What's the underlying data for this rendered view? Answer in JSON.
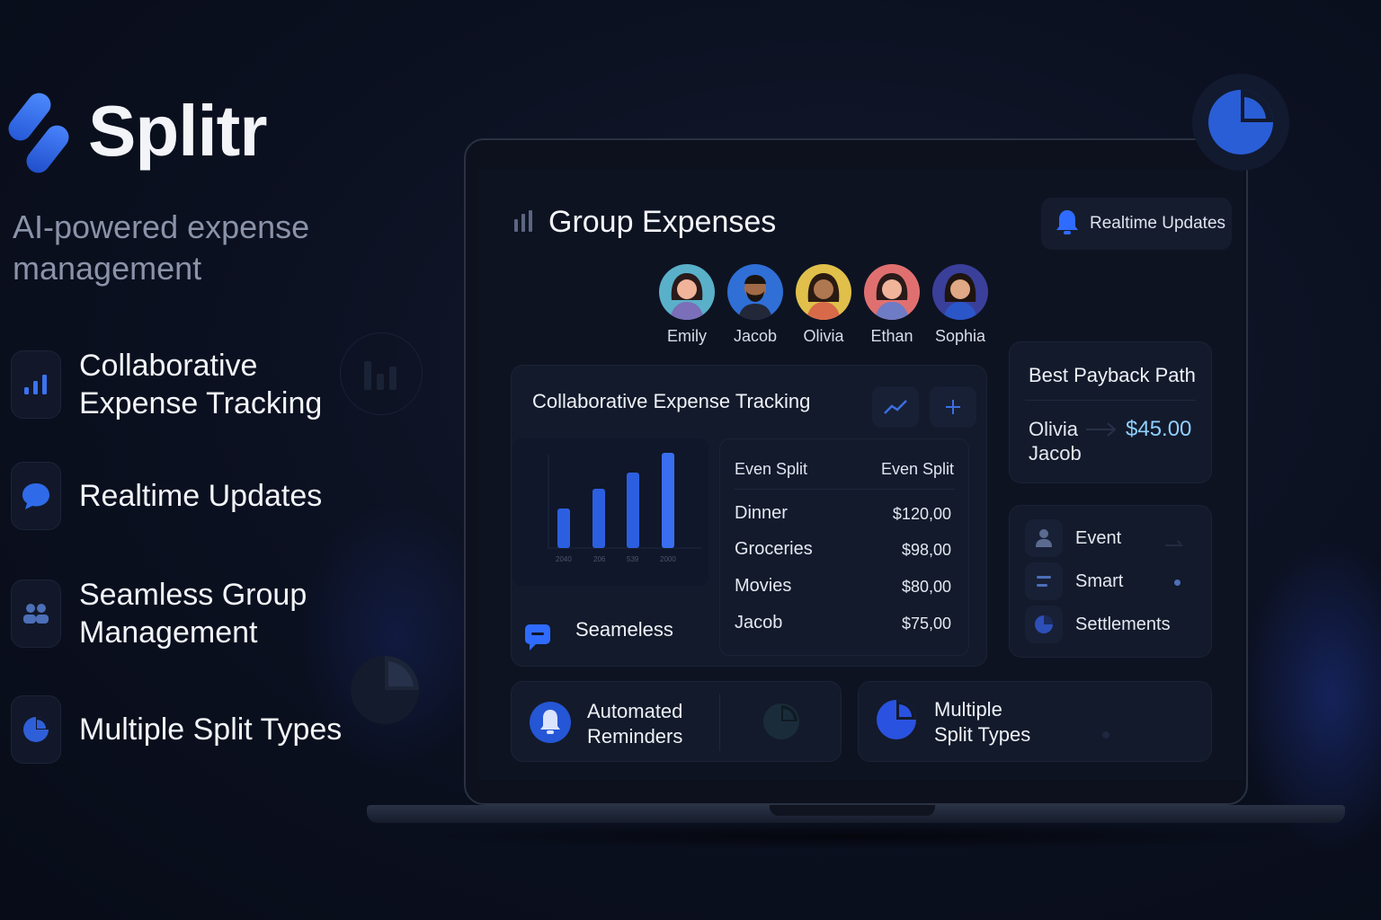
{
  "brand": {
    "name": "Splitr",
    "tagline": "AI-powered expense management"
  },
  "features": [
    {
      "label": "Collaborative Expense Tracking",
      "icon": "bar-chart-icon"
    },
    {
      "label": "Realtime Updates",
      "icon": "chat-bubble-icon"
    },
    {
      "label": "Seamless Group Management",
      "icon": "group-icon"
    },
    {
      "label": "Multiple Split Types",
      "icon": "pie-chart-icon"
    }
  ],
  "app": {
    "title": "Group Expenses",
    "realtime_label": "Realtime Updates",
    "members": [
      {
        "name": "Emily",
        "bg": "#5ab0c9"
      },
      {
        "name": "Jacob",
        "bg": "#2f6fd6"
      },
      {
        "name": "Olivia",
        "bg": "#e0c04a"
      },
      {
        "name": "Ethan",
        "bg": "#e07070"
      },
      {
        "name": "Sophia",
        "bg": "#3a3f9a"
      }
    ],
    "tracking": {
      "title": "Collaborative Expense Tracking",
      "chart_ticks": [
        "2040",
        "206",
        "539",
        "2000"
      ],
      "table_headers": [
        "Even Split",
        "Even Split"
      ],
      "rows": [
        {
          "label": "Dinner",
          "amount": "$120,00"
        },
        {
          "label": "Groceries",
          "amount": "$98,00"
        },
        {
          "label": "Movies",
          "amount": "$80,00"
        },
        {
          "label": "Jacob",
          "amount": "$75,00"
        }
      ]
    },
    "seamless_label": "Seameless",
    "payback": {
      "title": "Best Payback Path",
      "from": "Olivia",
      "to": "Jacob",
      "amount": "$45.00"
    },
    "options": [
      "Event",
      "Smart",
      "Settlements"
    ],
    "reminders_label_1": "Automated",
    "reminders_label_2": "Reminders",
    "split_label_1": "Multiple",
    "split_label_2": "Split Types"
  },
  "colors": {
    "accent": "#2f6bff",
    "amount": "#8fd0ff",
    "background": "#0b1020"
  }
}
